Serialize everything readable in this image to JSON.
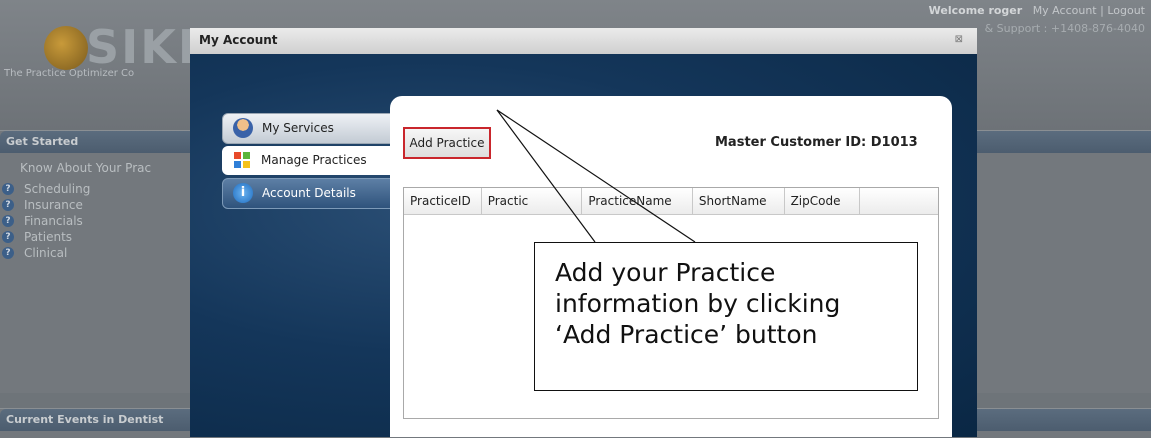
{
  "app": {
    "logo_text": "SIKK",
    "tagline": "The Practice Optimizer Co",
    "welcome_prefix": "Welcome roger",
    "my_account_link": "My Account",
    "separator": "|",
    "logout_link": "Logout",
    "support_text": "& Support : +1408-876-4040"
  },
  "get_started": {
    "title": "Get Started",
    "know_about": "Know About Your Prac",
    "items": [
      {
        "label": "Scheduling"
      },
      {
        "label": "Insurance"
      },
      {
        "label": "Financials"
      },
      {
        "label": "Patients"
      },
      {
        "label": "Clinical"
      }
    ]
  },
  "current_events": {
    "title": "Current Events in Dentist"
  },
  "modal": {
    "title": "My Account",
    "close_glyph": "⊠",
    "tabs": [
      {
        "label": "My Services",
        "icon": "user-icon"
      },
      {
        "label": "Manage Practices",
        "icon": "practices-icon"
      },
      {
        "label": "Account Details",
        "icon": "info-icon"
      }
    ],
    "add_practice_label": "Add Practice",
    "master_customer_id": "Master Customer ID: D1013",
    "grid_columns": [
      "PracticeID",
      "Practic",
      "PracticeName",
      "ShortName",
      "ZipCode",
      ""
    ]
  },
  "callout": {
    "lines": [
      "Add your Practice",
      "information by clicking",
      "‘Add Practice’ button"
    ]
  },
  "colors": {
    "highlight_border": "#c9262c",
    "modal_gradient_dark": "#0b2a4a",
    "active_tab_bg": "#ffffff"
  }
}
